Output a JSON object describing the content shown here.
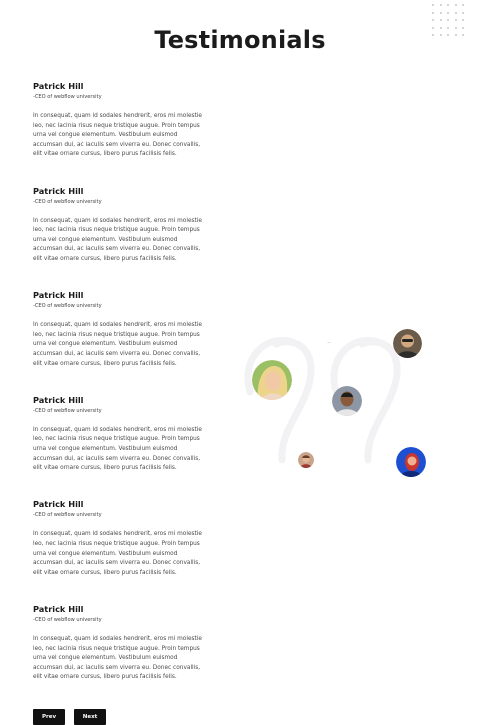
{
  "header": {
    "title": "Testimonials"
  },
  "testimonials": [
    {
      "name": "Patrick Hill",
      "role": "-CEO of webflow university",
      "body": "In consequat, quam id sodales hendrerit, eros mi molestie leo, nec lacinia risus neque tristique augue. Proin tempus urna vel congue elementum. Vestibulum euismod accumsan dui, ac iaculis sem viverra eu. Donec convallis, elit vitae ornare cursus, libero purus facilisis felis."
    },
    {
      "name": "Patrick Hill",
      "role": "-CEO of webflow university",
      "body": "In consequat, quam id sodales hendrerit, eros mi molestie leo, nec lacinia risus neque tristique augue. Proin tempus urna vel congue elementum. Vestibulum euismod accumsan dui, ac iaculis sem viverra eu. Donec convallis, elit vitae ornare cursus, libero purus facilisis felis."
    },
    {
      "name": "Patrick Hill",
      "role": "-CEO of webflow university",
      "body": "In consequat, quam id sodales hendrerit, eros mi molestie leo, nec lacinia risus neque tristique augue. Proin tempus urna vel congue elementum. Vestibulum euismod accumsan dui, ac iaculis sem viverra eu. Donec convallis, elit vitae ornare cursus, libero purus facilisis felis."
    },
    {
      "name": "Patrick Hill",
      "role": "-CEO of webflow university",
      "body": "In consequat, quam id sodales hendrerit, eros mi molestie leo, nec lacinia risus neque tristique augue. Proin tempus urna vel congue elementum. Vestibulum euismod accumsan dui, ac iaculis sem viverra eu. Donec convallis, elit vitae ornare cursus, libero purus facilisis felis."
    },
    {
      "name": "Patrick Hill",
      "role": "-CEO of webflow university",
      "body": "In consequat, quam id sodales hendrerit, eros mi molestie leo, nec lacinia risus neque tristique augue. Proin tempus urna vel congue elementum. Vestibulum euismod accumsan dui, ac iaculis sem viverra eu. Donec convallis, elit vitae ornare cursus, libero purus facilisis felis."
    },
    {
      "name": "Patrick Hill",
      "role": "-CEO of webflow university",
      "body": "In consequat, quam id sodales hendrerit, eros mi molestie leo, nec lacinia risus neque tristique augue. Proin tempus urna vel congue elementum. Vestibulum euismod accumsan dui, ac iaculis sem viverra eu. Donec convallis, elit vitae ornare cursus, libero purus facilisis felis."
    }
  ],
  "pagination": {
    "prev_label": "Prev",
    "next_label": "Next"
  },
  "colors": {
    "button_bg": "#111111",
    "button_text": "#ffffff",
    "quote_mark": "#f2f2f4",
    "dots": "#c7c7cf"
  }
}
